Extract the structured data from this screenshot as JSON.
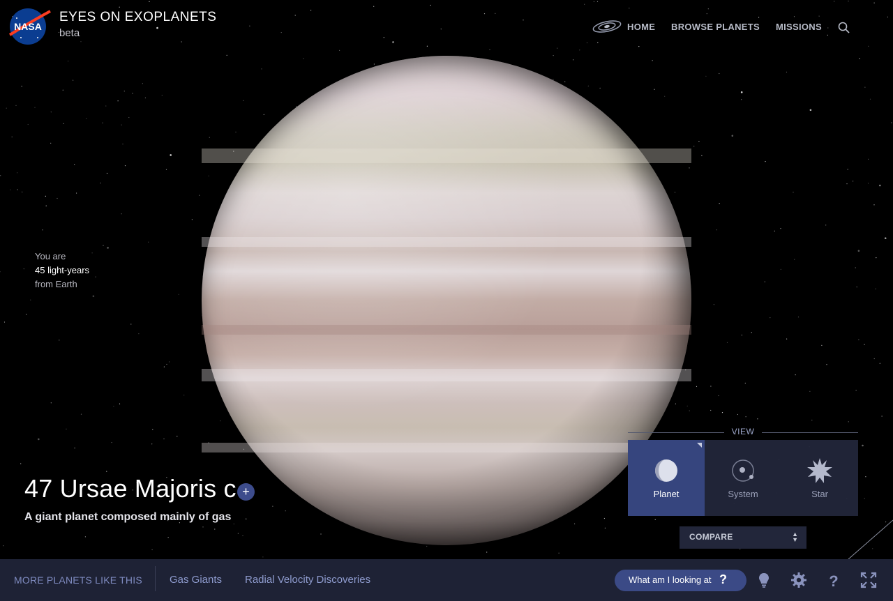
{
  "header": {
    "logo_text": "NASA",
    "app_title": "EYES ON EXOPLANETS",
    "app_subtitle": "beta",
    "nav": [
      {
        "label": "HOME",
        "icon": "galaxy-icon"
      },
      {
        "label": "BROWSE PLANETS"
      },
      {
        "label": "MISSIONS"
      }
    ],
    "search_icon": "search-icon"
  },
  "distance": {
    "line1": "You are",
    "line2": "45 light-years",
    "line3": "from Earth"
  },
  "planet": {
    "name": "47 Ursae Majoris c",
    "add_label": "+",
    "description": "A giant planet composed mainly of gas"
  },
  "view": {
    "label": "VIEW",
    "options": [
      {
        "label": "Planet",
        "icon": "planet-icon",
        "active": true
      },
      {
        "label": "System",
        "icon": "system-icon",
        "active": false
      },
      {
        "label": "Star",
        "icon": "star-icon",
        "active": false
      }
    ],
    "compare_label": "COMPARE"
  },
  "bottom": {
    "more_label": "MORE PLANETS LIKE THIS",
    "links": [
      "Gas Giants",
      "Radial Velocity Discoveries"
    ],
    "what_label": "What am I looking at",
    "what_q": "?",
    "tools": [
      "lightbulb-icon",
      "settings-gear-icon",
      "help-icon",
      "fullscreen-icon"
    ]
  },
  "colors": {
    "accent": "#36457e",
    "bar": "#1e2235",
    "link": "#8f9ccf"
  }
}
